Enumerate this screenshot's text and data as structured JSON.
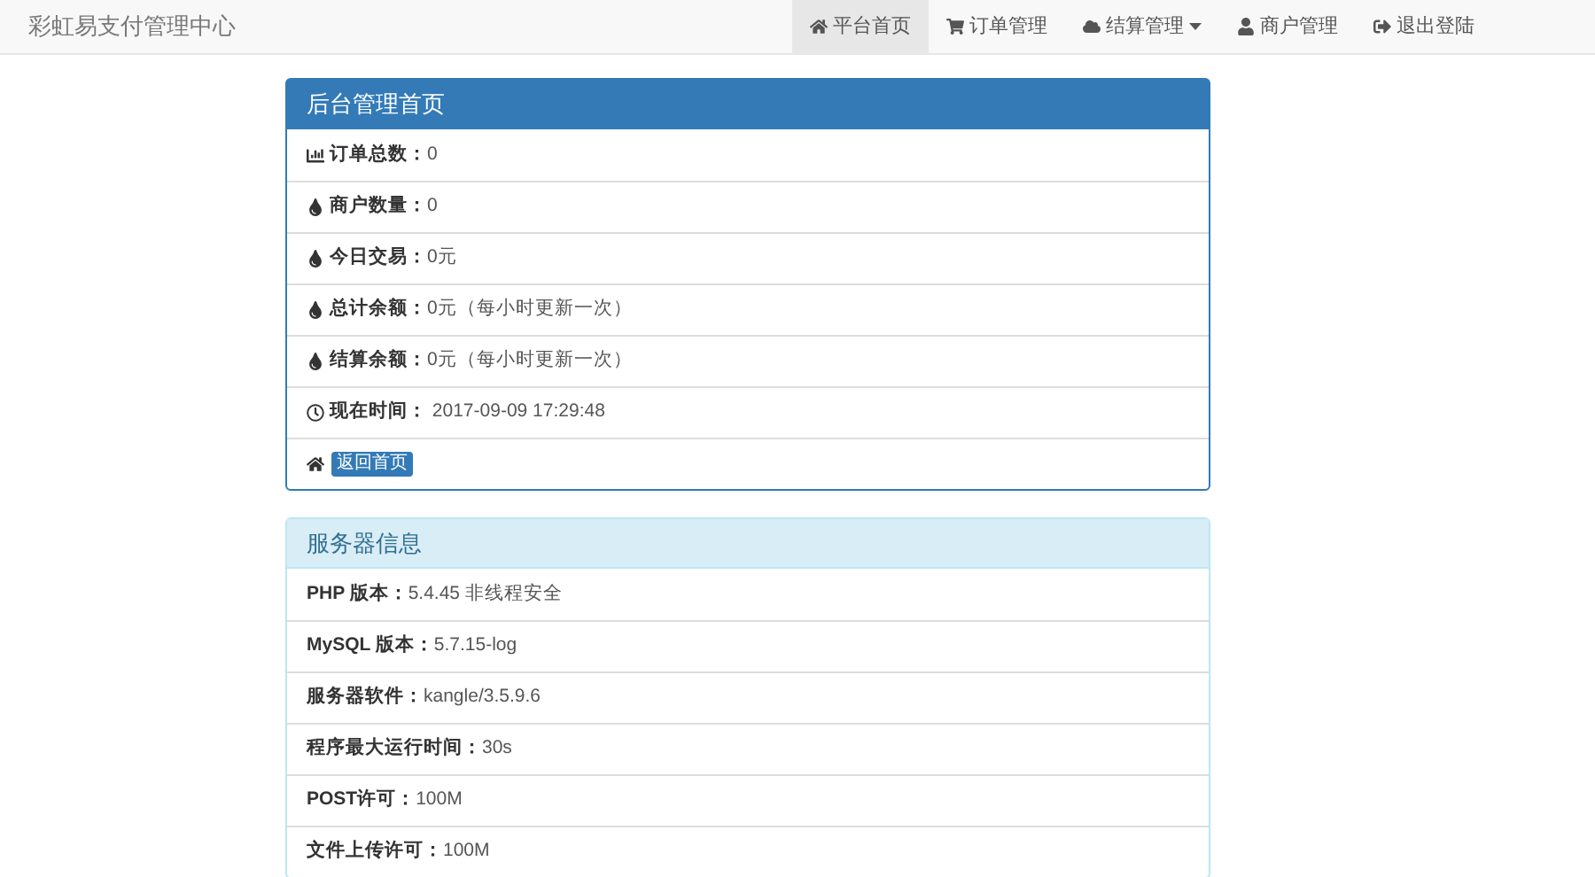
{
  "navbar": {
    "brand": "彩虹易支付管理中心",
    "items": [
      {
        "label": "平台首页",
        "kind": "home",
        "selected": true,
        "dropdown": false
      },
      {
        "label": "订单管理",
        "kind": "cart",
        "selected": false,
        "dropdown": false
      },
      {
        "label": "结算管理",
        "kind": "cloud",
        "selected": false,
        "dropdown": true
      },
      {
        "label": "商户管理",
        "kind": "user",
        "selected": false,
        "dropdown": false
      },
      {
        "label": "退出登陆",
        "kind": "signout",
        "selected": false,
        "dropdown": false
      }
    ]
  },
  "panels": [
    {
      "title": "后台管理首页",
      "kind": "primary",
      "rows": [
        {
          "kind": "bars",
          "label": "订单总数：",
          "value": "0"
        },
        {
          "kind": "tint",
          "label": "商户数量：",
          "value": "0"
        },
        {
          "kind": "tint",
          "label": "今日交易：",
          "value": "0元"
        },
        {
          "kind": "tint",
          "label": "总计余额：",
          "value": "0元（每小时更新一次）"
        },
        {
          "kind": "tint",
          "label": "结算余额：",
          "value": "0元（每小时更新一次）"
        },
        {
          "kind": "clock",
          "label": "现在时间：",
          "value": " 2017-09-09 17:29:48"
        },
        {
          "kind": "home",
          "button": "返回首页"
        }
      ]
    },
    {
      "title": "服务器信息",
      "kind": "info",
      "rows": [
        {
          "label": "PHP 版本：",
          "value": "5.4.45 非线程安全"
        },
        {
          "label": "MySQL 版本：",
          "value": "5.7.15-log"
        },
        {
          "label": "服务器软件：",
          "value": "kangle/3.5.9.6"
        },
        {
          "label": "程序最大运行时间：",
          "value": "30s"
        },
        {
          "label": "POST许可：",
          "value": "100M"
        },
        {
          "label": "文件上传许可：",
          "value": "100M"
        }
      ]
    }
  ]
}
